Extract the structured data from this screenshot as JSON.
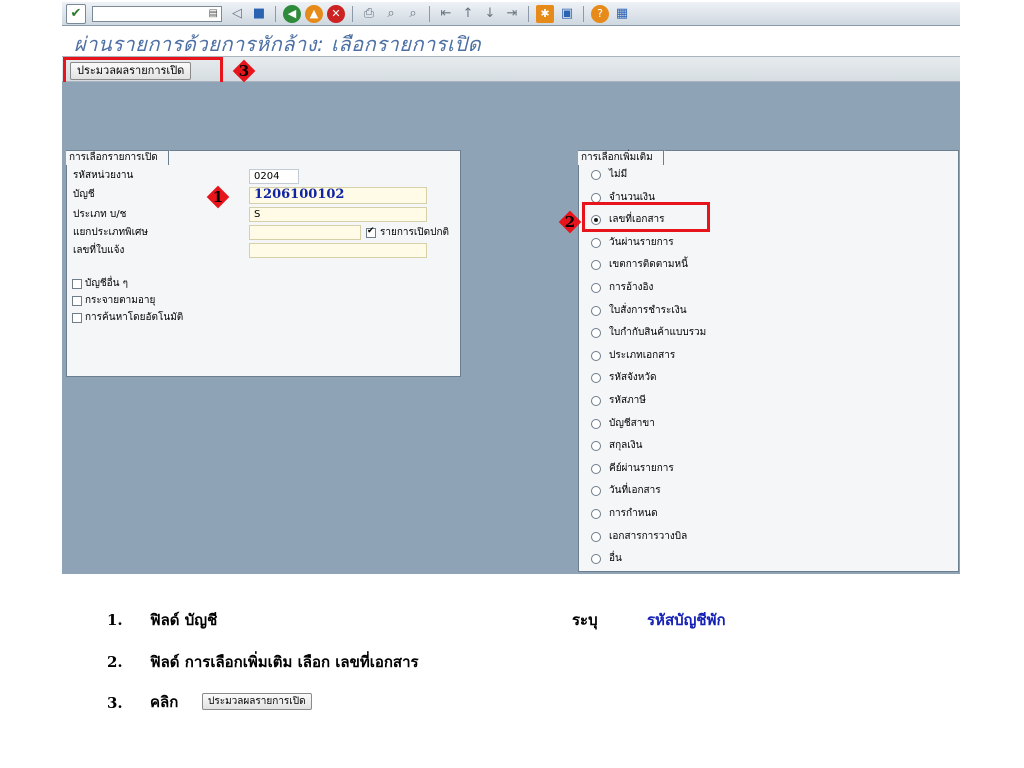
{
  "title": "ผ่านรายการด้วยการหักล้าง: เลือกรายการเปิด",
  "toolbar": {
    "command_field": "",
    "icons": [
      "check-icon",
      "save-icon",
      "back-icon",
      "exit-icon",
      "cancel-icon",
      "print-icon",
      "find-icon",
      "find-next-icon",
      "first-page-icon",
      "prev-page-icon",
      "next-page-icon",
      "last-page-icon",
      "new-session-icon",
      "shortcut-icon",
      "help-icon",
      "layout-icon"
    ]
  },
  "app_toolbar": {
    "process_button": "ประมวลผลรายการเปิด"
  },
  "callouts": {
    "one": "1",
    "two": "2",
    "three": "3"
  },
  "open_item_selection": {
    "title": "การเลือกรายการเปิด",
    "fields": [
      {
        "label": "รหัสหน่วยงาน",
        "value": "0204"
      },
      {
        "label": "บัญชี",
        "value": "1206100102"
      },
      {
        "label": "ประเภท บ/ช",
        "value": "S"
      },
      {
        "label": "แยกประเภทพิเศษ",
        "value": ""
      },
      {
        "label": "เลขที่ใบแจ้ง",
        "value": ""
      }
    ],
    "normal_open_items": {
      "label": "รายการเปิดปกติ",
      "checked": true
    },
    "checkboxes": [
      {
        "label": "บัญชีอื่น ๆ",
        "checked": false
      },
      {
        "label": "กระจายตามอายุ",
        "checked": false
      },
      {
        "label": "การค้นหาโดยอัตโนมัติ",
        "checked": false
      }
    ]
  },
  "additional_selection": {
    "title": "การเลือกเพิ่มเติม",
    "options": [
      {
        "label": "ไม่มี",
        "selected": false
      },
      {
        "label": "จำนวนเงิน",
        "selected": false
      },
      {
        "label": "เลขที่เอกสาร",
        "selected": true
      },
      {
        "label": "วันผ่านรายการ",
        "selected": false
      },
      {
        "label": "เขตการติดตามหนี้",
        "selected": false
      },
      {
        "label": "การอ้างอิง",
        "selected": false
      },
      {
        "label": "ใบสั่งการชำระเงิน",
        "selected": false
      },
      {
        "label": "ใบกำกับสินค้าแบบรวม",
        "selected": false
      },
      {
        "label": "ประเภทเอกสาร",
        "selected": false
      },
      {
        "label": "รหัสจังหวัด",
        "selected": false
      },
      {
        "label": "รหัสภาษี",
        "selected": false
      },
      {
        "label": "บัญชีสาขา",
        "selected": false
      },
      {
        "label": "สกุลเงิน",
        "selected": false
      },
      {
        "label": "คีย์ผ่านรายการ",
        "selected": false
      },
      {
        "label": "วันที่เอกสาร",
        "selected": false
      },
      {
        "label": "การกำหนด",
        "selected": false
      },
      {
        "label": "เอกสารการวางบิล",
        "selected": false
      },
      {
        "label": "อื่น",
        "selected": false
      }
    ]
  },
  "instructions": {
    "step1": {
      "num": "1.",
      "text": "ฟิลด์ บัญชี",
      "action": "ระบุ",
      "value": "รหัสบัญชีพัก"
    },
    "step2": {
      "num": "2.",
      "text": "ฟิลด์ การเลือกเพิ่มเติม เลือก เลขที่เอกสาร"
    },
    "step3": {
      "num": "3.",
      "text": "คลิก",
      "button": "ประมวลผลรายการเปิด"
    }
  }
}
